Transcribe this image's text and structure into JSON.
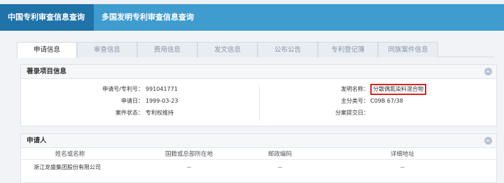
{
  "top_nav": {
    "tabs": [
      {
        "label": "中国专利审查信息查询"
      },
      {
        "label": "多国发明专利审查信息查询"
      }
    ]
  },
  "sub_tabs": [
    "申请信息",
    "审查信息",
    "费用信息",
    "发文信息",
    "公布公告",
    "专利登记簿",
    "同族案件信息"
  ],
  "bibliographic": {
    "heading": "著录项目信息",
    "application_number_label": "申请号/专利号：",
    "application_number": "991041771",
    "application_date_label": "申请日：",
    "application_date": "1999-03-23",
    "case_status_label": "案件状态：",
    "case_status": "专利权维持",
    "invention_name_label": "发明名称：",
    "invention_name": "分散偶氮染料混合物",
    "main_class_label": "主分类号：",
    "main_class": "C09B 67/38",
    "division_date_label": "分案提交日：",
    "division_date": ""
  },
  "applicant": {
    "heading": "申请人",
    "columns": [
      "姓名或名称",
      "国籍或总部所在地",
      "邮政编码",
      "详细地址"
    ],
    "rows": [
      {
        "name": "浙江龙盛集团股份有限公司",
        "nationality": "--",
        "postal_code": "--",
        "address": "--"
      }
    ]
  },
  "colors": {
    "nav_bg": "#3f9ccf",
    "nav_active": "#1f73a8",
    "highlight_border": "#e02020"
  }
}
